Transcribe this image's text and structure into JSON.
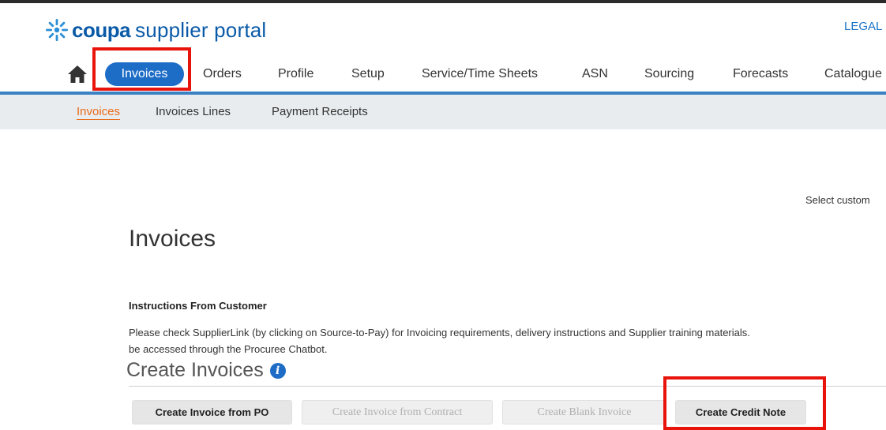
{
  "header": {
    "brand": "coupa",
    "brand_sub": "supplier portal",
    "legal_link": "LEGAL"
  },
  "nav": {
    "items": [
      "Invoices",
      "Orders",
      "Profile",
      "Setup",
      "Service/Time Sheets",
      "ASN",
      "Sourcing",
      "Forecasts",
      "Catalogue"
    ],
    "active": "Invoices"
  },
  "subnav": {
    "items": [
      "Invoices",
      "Invoices Lines",
      "Payment Receipts"
    ]
  },
  "select_customer": "Select custom",
  "page": {
    "title": "Invoices"
  },
  "instructions": {
    "heading": "Instructions From Customer",
    "line1": "Please check SupplierLink (by clicking on Source-to-Pay) for Invoicing requirements, delivery instructions and Supplier training materials.",
    "line2": "be accessed through the Procuree Chatbot."
  },
  "create": {
    "title": "Create Invoices",
    "info_icon_glyph": "i",
    "buttons": {
      "from_po": "Create Invoice from PO",
      "from_contract": "Create Invoice from Contract",
      "blank": "Create Blank Invoice",
      "credit_note": "Create Credit Note"
    }
  },
  "colors": {
    "brand_blue": "#0a5aa8",
    "nav_active": "#1d6dc7",
    "subnav_active": "#e96a1a",
    "highlight_red": "#e8140c"
  }
}
